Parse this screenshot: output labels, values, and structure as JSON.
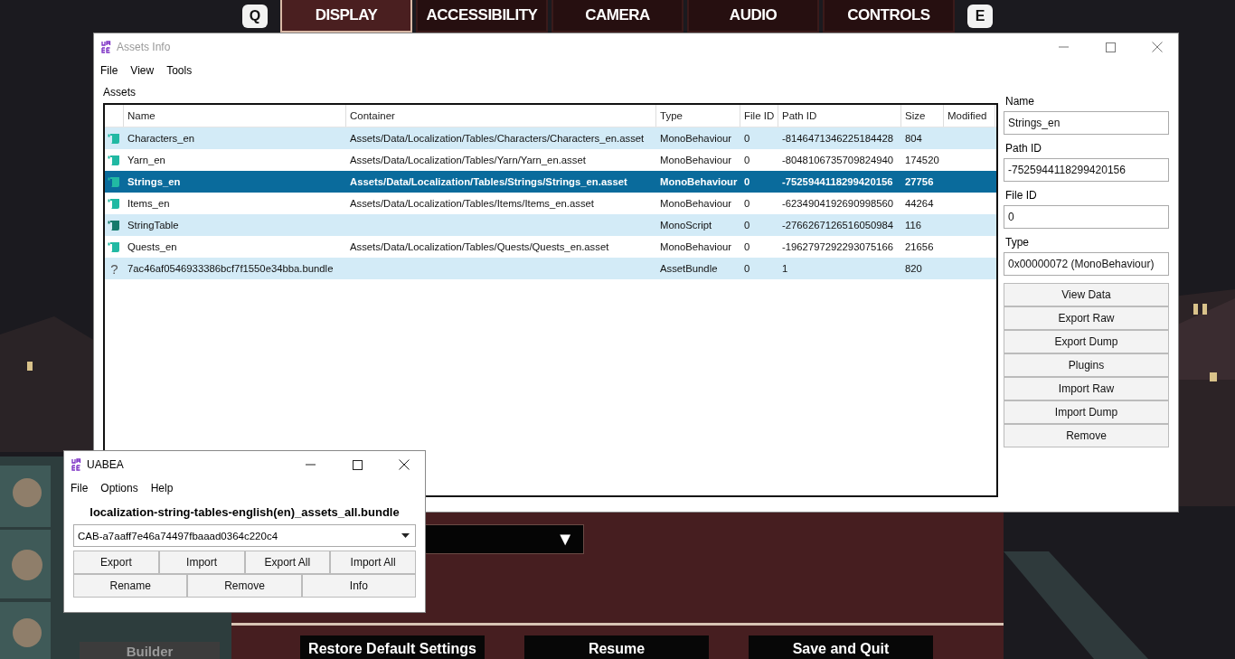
{
  "game": {
    "tabs": [
      {
        "label": "DISPLAY",
        "selected": true
      },
      {
        "label": "ACCESSIBILITY",
        "selected": false
      },
      {
        "label": "CAMERA",
        "selected": false
      },
      {
        "label": "AUDIO",
        "selected": false
      },
      {
        "label": "CONTROLS",
        "selected": false
      }
    ],
    "key_left": "Q",
    "key_right": "E",
    "dropdown_arrow": "▼",
    "character_label": "Builder",
    "buttons": [
      "Restore Default Settings",
      "Resume",
      "Save and Quit"
    ]
  },
  "assets_window": {
    "title": "Assets Info",
    "menu": [
      "File",
      "View",
      "Tools"
    ],
    "section_label": "Assets",
    "table": {
      "columns": [
        "Name",
        "Container",
        "Type",
        "File ID",
        "Path ID",
        "Size",
        "Modified"
      ],
      "rows": [
        {
          "kind": "behaviour",
          "selected": false,
          "cells": [
            "Characters_en",
            "Assets/Data/Localization/Tables/Characters/Characters_en.asset",
            "MonoBehaviour",
            "0",
            "-8146471346225184428",
            "804"
          ]
        },
        {
          "kind": "behaviour",
          "selected": false,
          "cells": [
            "Yarn_en",
            "Assets/Data/Localization/Tables/Yarn/Yarn_en.asset",
            "MonoBehaviour",
            "0",
            "-8048106735709824940",
            "174520"
          ]
        },
        {
          "kind": "behaviour",
          "selected": true,
          "cells": [
            "Strings_en",
            "Assets/Data/Localization/Tables/Strings/Strings_en.asset",
            "MonoBehaviour",
            "0",
            "-7525944118299420156",
            "27756"
          ]
        },
        {
          "kind": "behaviour",
          "selected": false,
          "cells": [
            "Items_en",
            "Assets/Data/Localization/Tables/Items/Items_en.asset",
            "MonoBehaviour",
            "0",
            "-6234904192690998560",
            "44264"
          ]
        },
        {
          "kind": "script",
          "selected": false,
          "cells": [
            "StringTable",
            "",
            "MonoScript",
            "0",
            "-2766267126516050984",
            "116"
          ]
        },
        {
          "kind": "behaviour",
          "selected": false,
          "cells": [
            "Quests_en",
            "Assets/Data/Localization/Tables/Quests/Quests_en.asset",
            "MonoBehaviour",
            "0",
            "-1962797292293075166",
            "21656"
          ]
        },
        {
          "kind": "unknown",
          "selected": false,
          "icon_char": "?",
          "cells": [
            "7ac46af0546933386bcf7f1550e34bba.bundle",
            "",
            "AssetBundle",
            "0",
            "1",
            "820"
          ]
        }
      ]
    },
    "fields": [
      {
        "label": "Name",
        "value": "Strings_en"
      },
      {
        "label": "Path ID",
        "value": "-7525944118299420156"
      },
      {
        "label": "File ID",
        "value": "0"
      },
      {
        "label": "Type",
        "value": "0x00000072 (MonoBehaviour)"
      }
    ],
    "buttons": [
      "View Data",
      "Export Raw",
      "Export Dump",
      "Plugins",
      "Import Raw",
      "Import Dump",
      "Remove"
    ]
  },
  "uabea_window": {
    "title": "UABEA",
    "menu": [
      "File",
      "Options",
      "Help"
    ],
    "bundle_name": "localization-string-tables-english(en)_assets_all.bundle",
    "selected_file": "CAB-a7aaff7e46a74497fbaaad0364c220c4",
    "buttons_row_1": [
      "Export",
      "Import",
      "Export All",
      "Import All"
    ],
    "buttons_row_2": [
      "Rename",
      "Remove",
      "Info"
    ]
  }
}
